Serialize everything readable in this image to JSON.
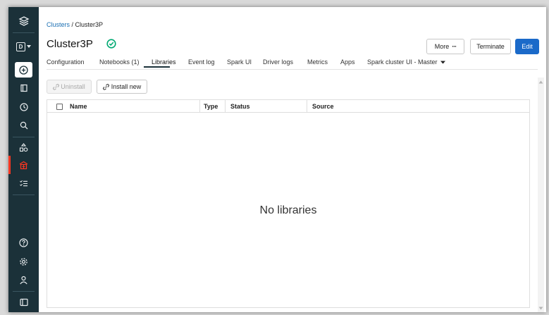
{
  "breadcrumb": {
    "parent": "Clusters",
    "separator": " / ",
    "current": "Cluster3P"
  },
  "cluster": {
    "name": "Cluster3P",
    "status_color": "#00a972"
  },
  "actions": {
    "more": "More",
    "more_glyph": "···",
    "terminate": "Terminate",
    "edit": "Edit"
  },
  "tabs": [
    {
      "label": "Configuration"
    },
    {
      "label": "Notebooks (1)"
    },
    {
      "label": "Libraries",
      "active": true
    },
    {
      "label": "Event log"
    },
    {
      "label": "Spark UI"
    },
    {
      "label": "Driver logs"
    },
    {
      "label": "Metrics"
    },
    {
      "label": "Apps"
    },
    {
      "label": "Spark cluster UI - Master"
    }
  ],
  "toolbar": {
    "uninstall": "Uninstall",
    "install_new": "Install new"
  },
  "table": {
    "columns": [
      "Name",
      "Type",
      "Status",
      "Source"
    ],
    "empty_message": "No libraries"
  },
  "sidebar": {
    "icons": [
      "databricks-logo-icon",
      "workspace-switcher-icon",
      "create-icon",
      "workspace-icon",
      "recents-icon",
      "search-icon",
      "data-icon",
      "compute-icon",
      "jobs-icon",
      "help-icon",
      "settings-icon",
      "user-icon",
      "collapse-menu-icon"
    ],
    "workspace_letter": "D",
    "active_color": "#ff3621"
  }
}
